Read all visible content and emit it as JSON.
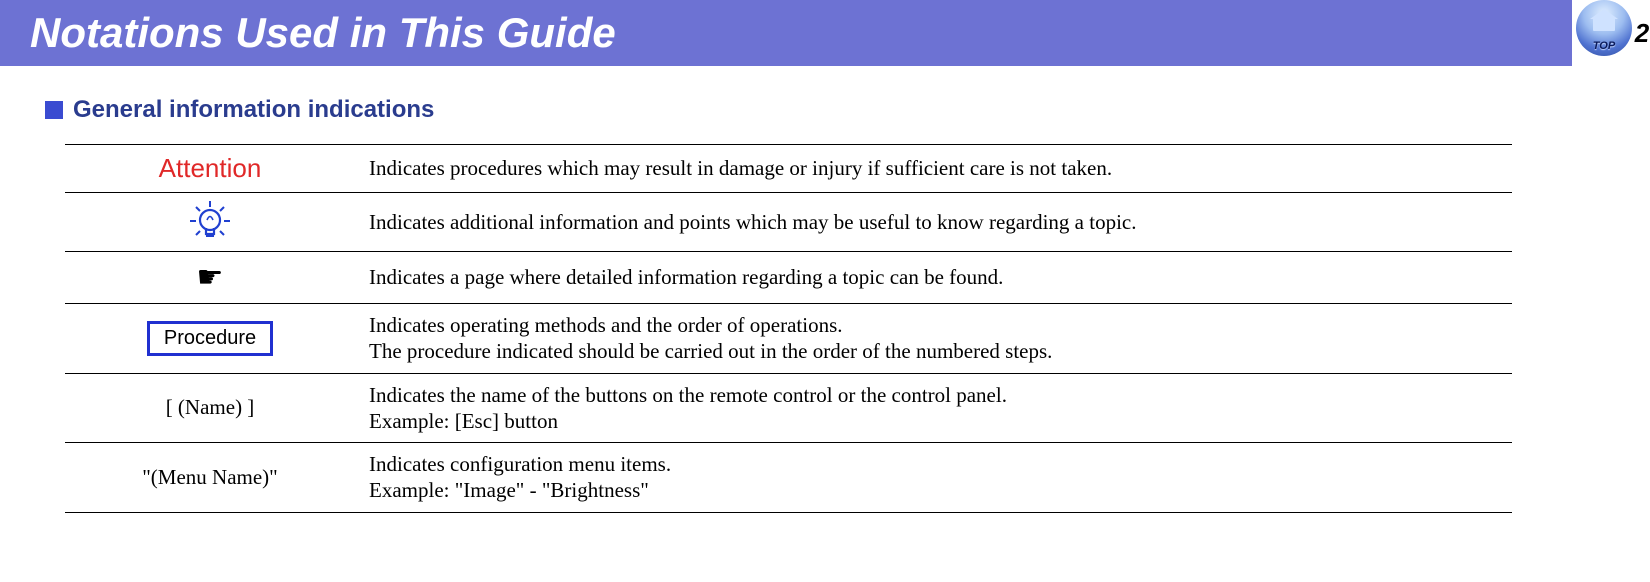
{
  "page": {
    "title": "Notations Used in This Guide",
    "section_title": "General information indications",
    "page_number": "2",
    "top_label": "TOP"
  },
  "rows": [
    {
      "label_type": "attention",
      "label": "Attention",
      "desc": "Indicates procedures which may result in damage or injury if sufficient care is not taken."
    },
    {
      "label_type": "tip",
      "label": "",
      "desc": "Indicates additional information and points which may be useful to know regarding a topic."
    },
    {
      "label_type": "pointer",
      "label": "",
      "desc": "Indicates a page where detailed information regarding a topic can be found."
    },
    {
      "label_type": "procedure",
      "label": "Procedure",
      "desc": "Indicates operating methods and the order of operations.\nThe procedure indicated should be carried out in the order of the numbered steps."
    },
    {
      "label_type": "name",
      "label": "[ (Name) ]",
      "desc": "Indicates the name of the buttons on the remote control or the control panel.\nExample: [Esc] button"
    },
    {
      "label_type": "menu",
      "label": "\"(Menu Name)\"",
      "desc": "Indicates configuration menu items.\nExample: \"Image\" - \"Brightness\""
    }
  ]
}
